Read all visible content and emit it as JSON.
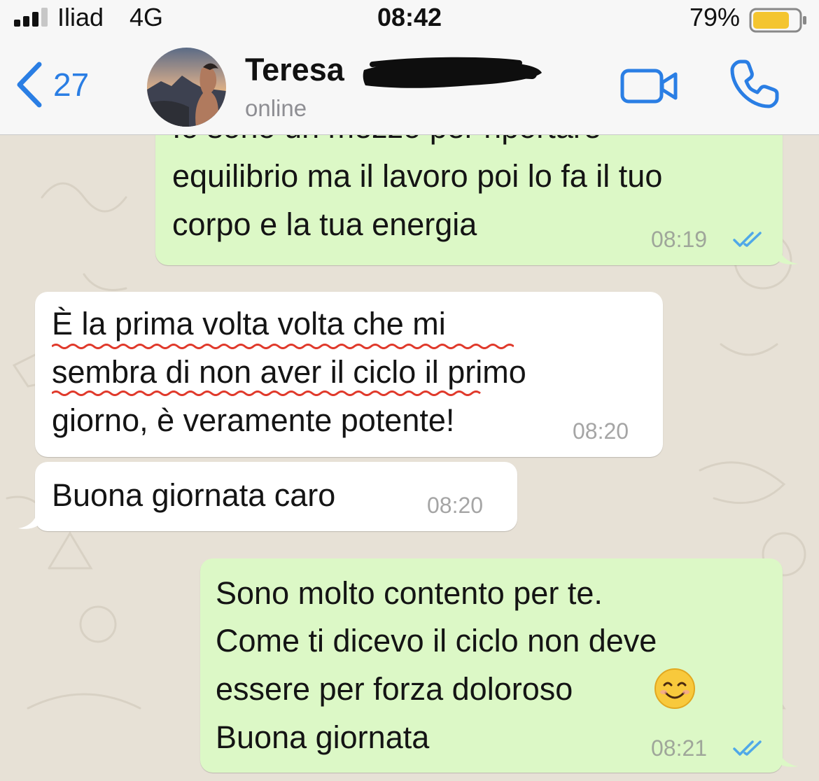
{
  "status_bar": {
    "carrier": "Iliad",
    "network": "4G",
    "time": "08:42",
    "battery": "79%",
    "battery_level": 0.79
  },
  "header": {
    "back_count": "27",
    "contact_name": "Teresa",
    "contact_status": "online"
  },
  "messages": [
    {
      "direction": "outgoing",
      "lines": [
        "Io sono un mezzo per riportare",
        "equilibrio ma il lavoro poi lo fa il tuo",
        "corpo e la tua energia"
      ],
      "time": "08:19",
      "status": "read"
    },
    {
      "direction": "incoming",
      "lines": [
        "È la prima volta volta che mi",
        "sembra di non aver il ciclo il primo",
        "giorno, è veramente potente!"
      ],
      "time": "08:20"
    },
    {
      "direction": "incoming",
      "lines": [
        "Buona giornata caro"
      ],
      "time": "08:20"
    },
    {
      "direction": "outgoing",
      "lines": [
        "Sono molto contento per te.",
        "Come ti dicevo il ciclo non deve",
        "essere per forza doloroso",
        "Buona giornata"
      ],
      "time": "08:21",
      "status": "read"
    }
  ],
  "colors": {
    "accent": "#2a7ee4",
    "outgoing_bubble": "#dcf8c6",
    "incoming_bubble": "#ffffff",
    "read_ticks": "#4fa8e8",
    "underline": "#e0392b"
  }
}
